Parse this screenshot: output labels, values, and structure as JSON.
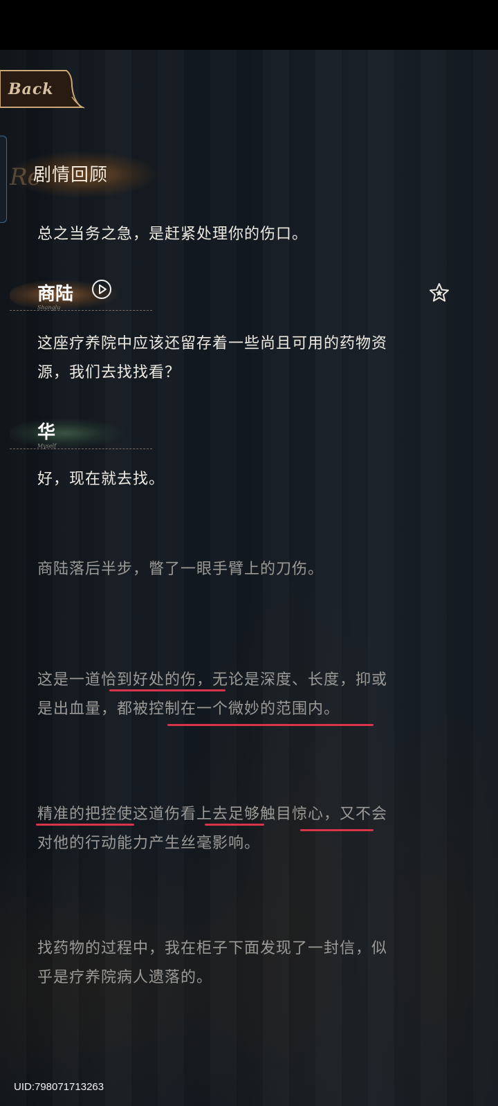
{
  "header": {
    "back_label": "Back",
    "section_title": "剧情回顾",
    "section_title_ghost": "Re"
  },
  "dialogue": [
    {
      "type": "speech",
      "text": "总之当务之急，是赶紧处理你的伤口。"
    },
    {
      "type": "speaker",
      "name": "商陆",
      "subname": "Shanglu",
      "has_voice": true,
      "favorite": true
    },
    {
      "type": "speech",
      "lines": [
        "这座疗养院中应该还留存着一些尚且可用的药物资",
        "源，我们去找找看？"
      ]
    },
    {
      "type": "speaker",
      "name": "华",
      "subname": "Myself",
      "has_voice": false
    },
    {
      "type": "speech",
      "text": "好，现在就去找。"
    },
    {
      "type": "narration",
      "text": "商陆落后半步，瞥了一眼手臂上的刀伤。"
    },
    {
      "type": "narration",
      "lines": [
        "这是一道恰到好处的伤，无论是深度、长度，抑或",
        "是出血量，都被控制在一个微妙的范围内。"
      ]
    },
    {
      "type": "narration",
      "lines": [
        "精准的把控使这道伤看上去足够触目惊心，又不会",
        "对他的行动能力产生丝毫影响。"
      ]
    },
    {
      "type": "narration",
      "lines": [
        "找药物的过程中，我在柜子下面发现了一封信，似",
        "乎是疗养院病人遗落的。"
      ]
    }
  ],
  "footer": {
    "uid": "UID:798071713263"
  },
  "colors": {
    "speech_text": "#eeeae2",
    "narration_text": "#9c9a96",
    "underline": "#d8344a",
    "speaker1_smudge": "#8a5a32",
    "speaker2_smudge": "#3e5a47",
    "gold": "#c9a978"
  },
  "icons": {
    "play": "play-circle-icon",
    "favorite": "star-icon"
  }
}
